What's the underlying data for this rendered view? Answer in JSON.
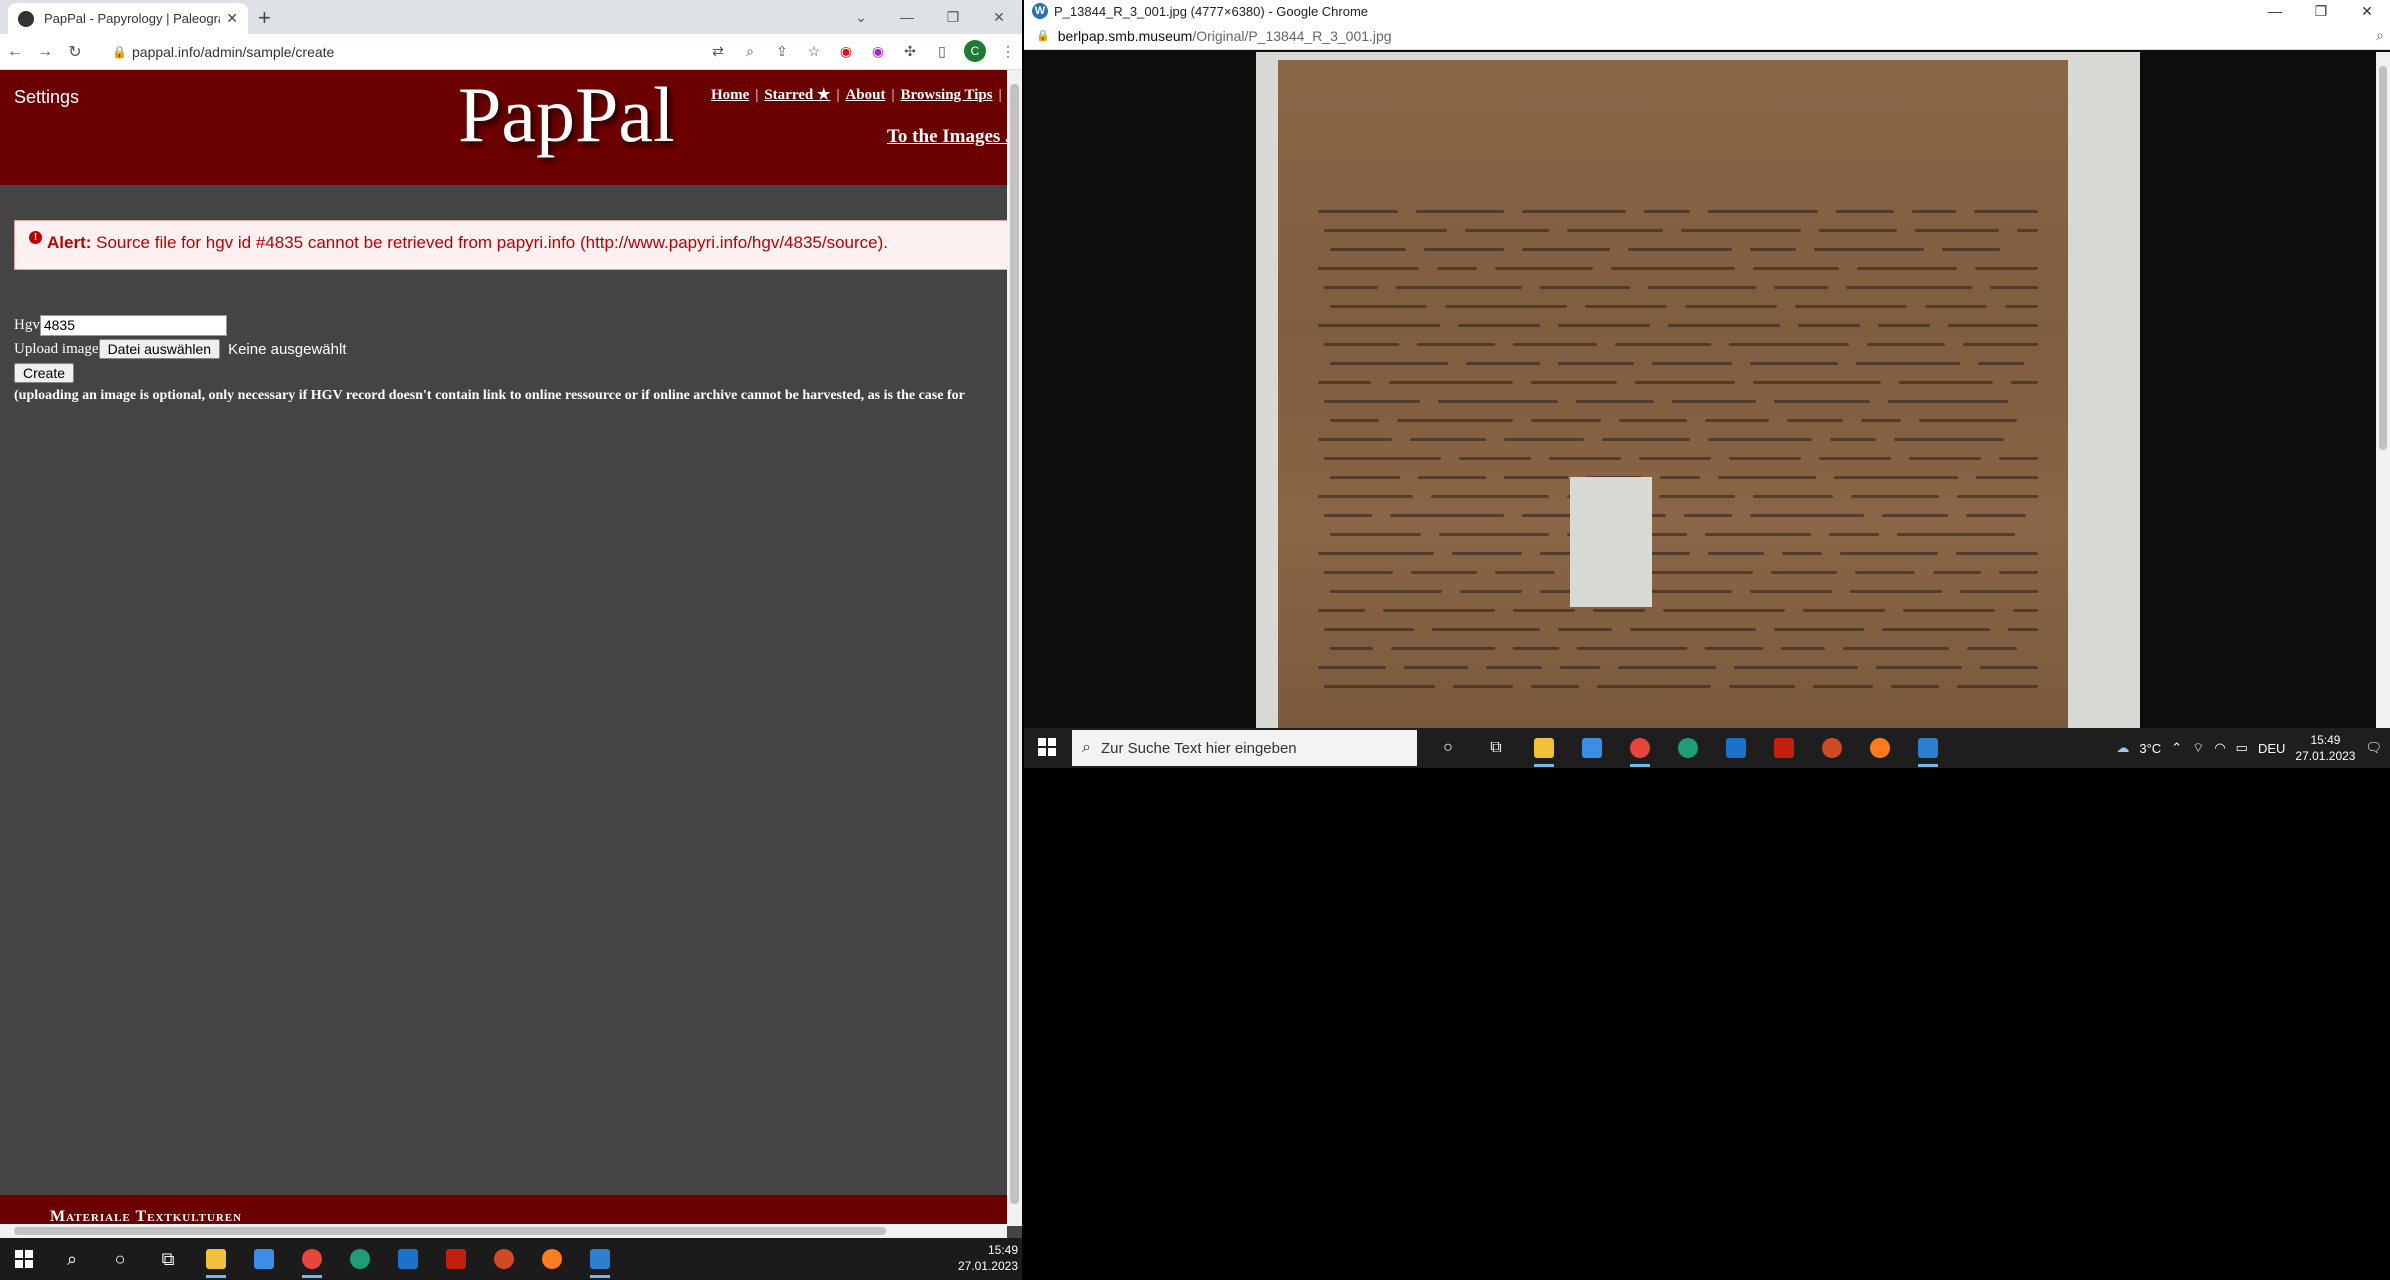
{
  "left_window": {
    "tab_title": "PapPal - Papyrology | Paleograph",
    "url": "pappal.info/admin/sample/create",
    "header": {
      "settings": "Settings",
      "logo": "PapPal",
      "menu": [
        "Home",
        "Starred ★",
        "About",
        "Browsing Tips"
      ],
      "menu_sep": "|",
      "to_images": "To the Images ..."
    },
    "alert": {
      "label": "Alert:",
      "message": "Source file for hgv id #4835 cannot be retrieved from papyri.info (http://www.papyri.info/hgv/4835/source)."
    },
    "form": {
      "hgv_label": "Hgv",
      "hgv_value": "4835",
      "upload_label": "Upload image",
      "file_button": "Datei auswählen",
      "file_status": "Keine ausgewählt",
      "create_button": "Create",
      "note": "(uploading an image is optional, only necessary if HGV record doesn't contain link to online ressource or if online archive cannot be harvested, as is the case for"
    },
    "footer": "Materiale Textkulturen",
    "taskbar": {
      "time": "15:49",
      "date": "27.01.2023"
    }
  },
  "right_window": {
    "title": "P_13844_R_3_001.jpg (4777×6380) - Google Chrome",
    "url_domain": "berlpap.smb.museum",
    "url_path": "/Original/P_13844_R_3_001.jpg",
    "taskbar": {
      "search_placeholder": "Zur Suche Text hier eingeben",
      "weather": "3°C",
      "lang": "DEU",
      "time": "15:49",
      "date": "27.01.2023"
    }
  },
  "colors": {
    "brand": "#6b0000",
    "alert_text": "#bb0000",
    "page_bg": "#444444"
  }
}
